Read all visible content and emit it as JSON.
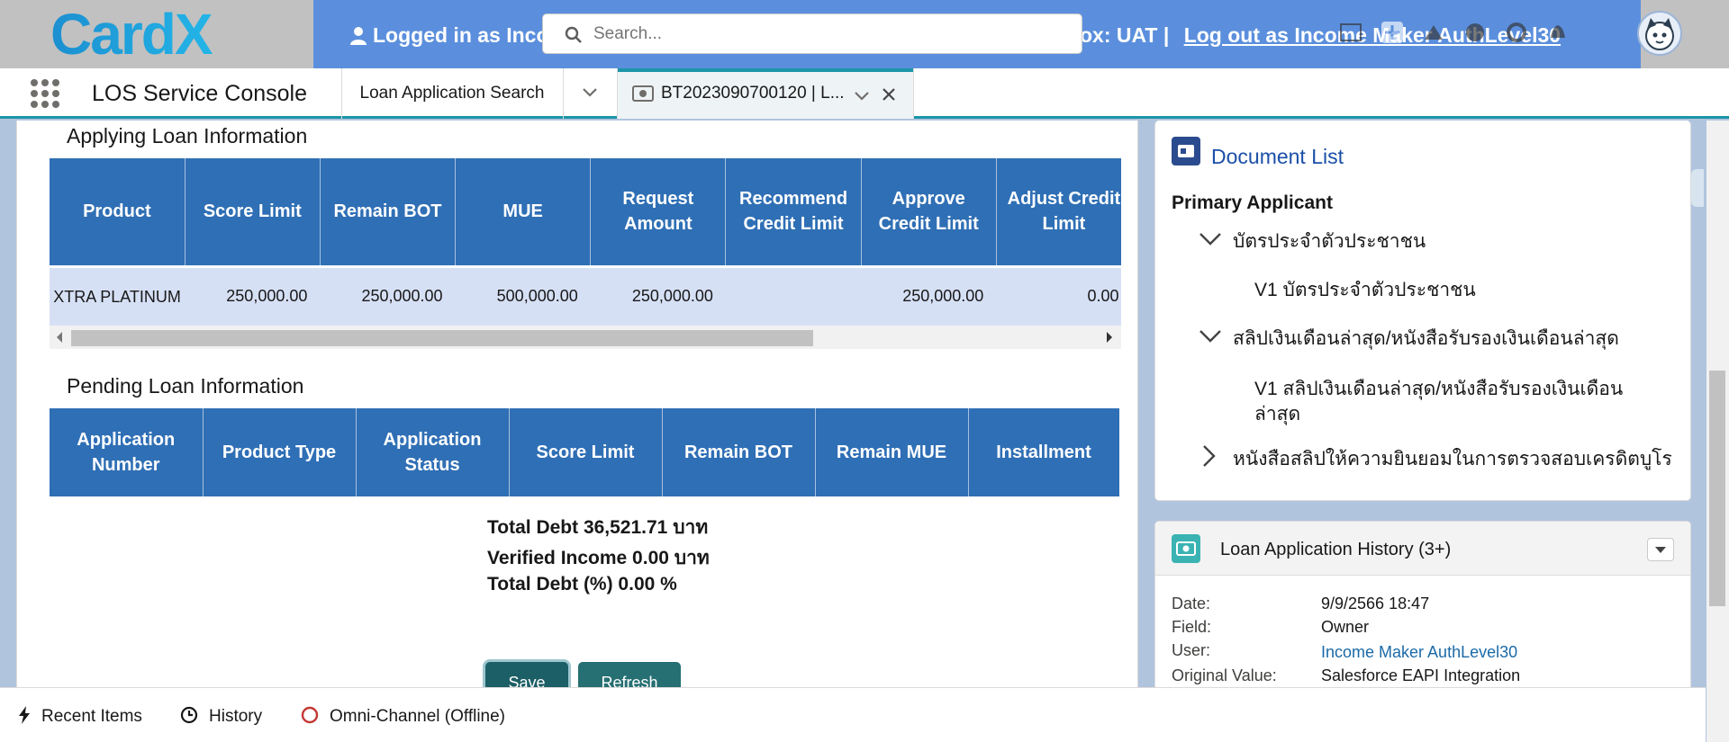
{
  "banner": {
    "logo_text": "CardX",
    "logged_in_text": "Logged in as Inco",
    "sandbox_text": "| Sandbox: UAT |",
    "logout_text": "Log out as Income Maker AuthLevel30",
    "search_placeholder": "Search..."
  },
  "nav": {
    "app_name": "LOS Service Console",
    "tab_search_label": "Loan Application Search",
    "active_tab_label": "BT2023090700120 | L..."
  },
  "applying": {
    "title": "Applying Loan Information",
    "headers": [
      "Product",
      "Score Limit",
      "Remain BOT",
      "MUE",
      "Request Amount",
      "Recommend Credit Limit",
      "Approve Credit Limit",
      "Adjust Credit Limit"
    ],
    "rows": [
      [
        "XTRA PLATINUM",
        "250,000.00",
        "250,000.00",
        "500,000.00",
        "250,000.00",
        "",
        "250,000.00",
        "0.00"
      ]
    ]
  },
  "pending": {
    "title": "Pending Loan Information",
    "headers": [
      "Application Number",
      "Product Type",
      "Application Status",
      "Score Limit",
      "Remain BOT",
      "Remain MUE",
      "Installment"
    ]
  },
  "totals": {
    "total_debt": "Total Debt 36,521.71 บาท",
    "verified_income": "Verified Income 0.00 บาท",
    "total_debt_pct": "Total Debt (%) 0.00 %"
  },
  "buttons": {
    "save": "Save",
    "refresh": "Refresh"
  },
  "document_list": {
    "title": "Document List",
    "primary_label": "Primary Applicant",
    "items": [
      {
        "label": "บัตรประจำตัวประชาชน",
        "expanded": true
      },
      {
        "label": "V1 บัตรประจำตัวประชาชน"
      },
      {
        "label": "สลิปเงินเดือนล่าสุด/หนังสือรับรองเงินเดือนล่าสุด",
        "expanded": true
      },
      {
        "label": "V1 สลิปเงินเดือนล่าสุด/หนังสือรับรองเงินเดือน",
        "label2": "ล่าสุด"
      },
      {
        "label": "หนังสือสลิปให้ความยินยอมในการตรวจสอบเครดิตบูโร",
        "expanded": false
      }
    ]
  },
  "history": {
    "title": "Loan Application History (3+)",
    "date_label": "Date:",
    "date_value": "9/9/2566 18:47",
    "field_label": "Field:",
    "field_value": "Owner",
    "user_label": "User:",
    "user_value": "Income Maker AuthLevel30",
    "orig_label": "Original Value:",
    "orig_value": "Salesforce EAPI Integration"
  },
  "utility": {
    "recent_items": "Recent Items",
    "history": "History",
    "omni_channel": "Omni-Channel (Offline)"
  },
  "colors": {
    "banner": "#5b8fdd",
    "table_header": "#2f6fb5",
    "row_bg": "#d6e0f5",
    "accent": "#1b96a8",
    "button": "#266f72"
  }
}
